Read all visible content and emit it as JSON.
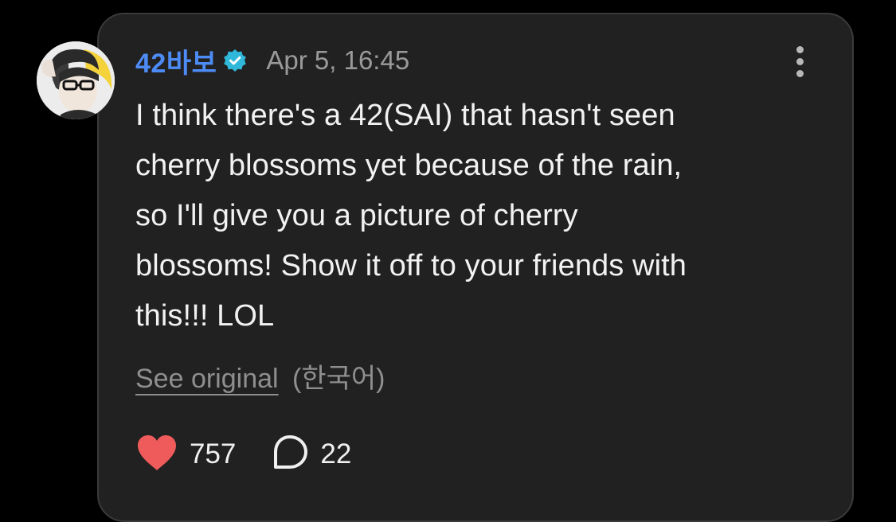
{
  "post": {
    "username": "42바보",
    "timestamp": "Apr 5, 16:45",
    "verified_icon": "verified-badge-icon",
    "more_icon": "more-vertical-icon",
    "body_lines": [
      "I think there's a 42(SAI) that hasn't seen",
      "cherry blossoms yet because of the rain,",
      "so I'll give you a picture of cherry",
      "blossoms! Show it off to your friends with",
      "this!!! LOL"
    ],
    "see_original_label": "See original",
    "original_language": "(한국어)",
    "likes": "757",
    "comments": "22"
  },
  "colors": {
    "background": "#000000",
    "card": "#212121",
    "username": "#4d8bf5",
    "verified": "#2fb8d9",
    "heart": "#ef5b5b",
    "muted": "#9a9a9a",
    "text": "#f2f2f2"
  }
}
